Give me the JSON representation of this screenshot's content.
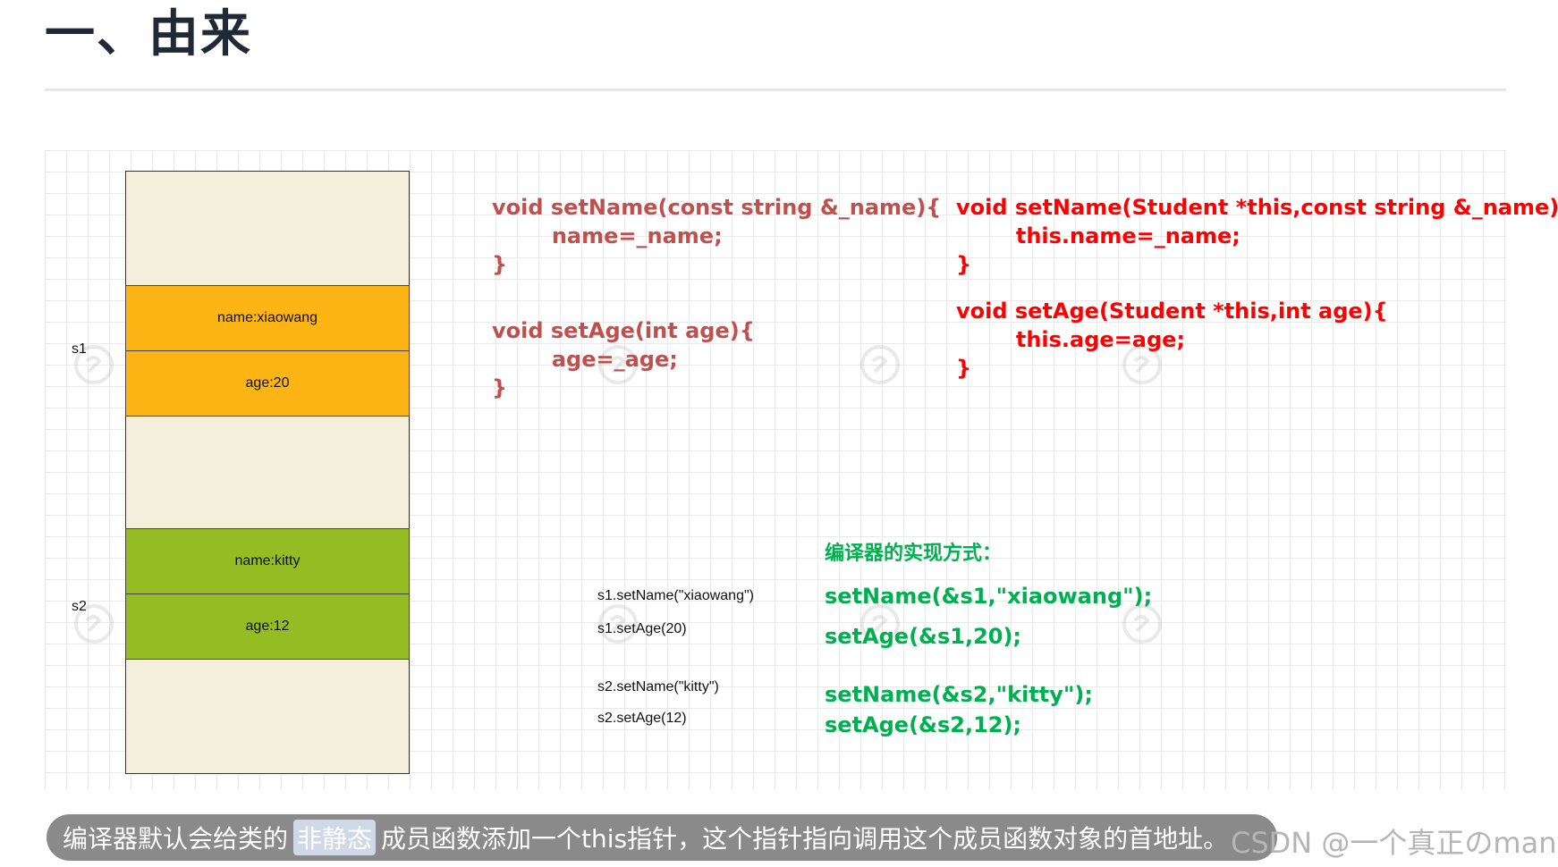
{
  "page": {
    "title": "一、由来"
  },
  "memory": {
    "s1_label": "s1",
    "s2_label": "s2",
    "s1_name": "name:xiaowang",
    "s1_age": "age:20",
    "s2_name": "name:kitty",
    "s2_age": "age:12"
  },
  "code_source": {
    "line1": "void setName(const string &_name){",
    "line2": "        name=_name;",
    "line3": "}",
    "line4": "void setAge(int age){",
    "line5": "        age=_age;",
    "line6": "}"
  },
  "code_compiled": {
    "line1": "void setName(Student *this,const string &_name){",
    "line2": "        this.name=_name;",
    "line3": "}",
    "line4": "void setAge(Student *this,int age){",
    "line5": "        this.age=age;",
    "line6": "}"
  },
  "calls": {
    "c1": "s1.setName(\"xiaowang\")",
    "c2": "s1.setAge(20)",
    "c3": "s2.setName(\"kitty\")",
    "c4": "s2.setAge(12)"
  },
  "compiler": {
    "heading": "编译器的实现方式：",
    "l1": "setName(&s1,\"xiaowang\");",
    "l2": "setAge(&s1,20);",
    "l3": "setName(&s2,\"kitty\");",
    "l4": "setAge(&s2,12);"
  },
  "footer": {
    "before": "编译器默认会给类的",
    "highlight": "非静态",
    "after": "成员函数添加一个this指针，这个指针指向调用这个成员函数对象的首地址。"
  },
  "watermark": {
    "csdn": "CSDN @一个真正のman."
  },
  "colors": {
    "source_code": "#c0504d",
    "compiled_code": "#ff0000",
    "compiler_code": "#00b050",
    "orange_block": "#fdb515",
    "green_block": "#95bd23",
    "memory_bg": "#f4efdb"
  }
}
